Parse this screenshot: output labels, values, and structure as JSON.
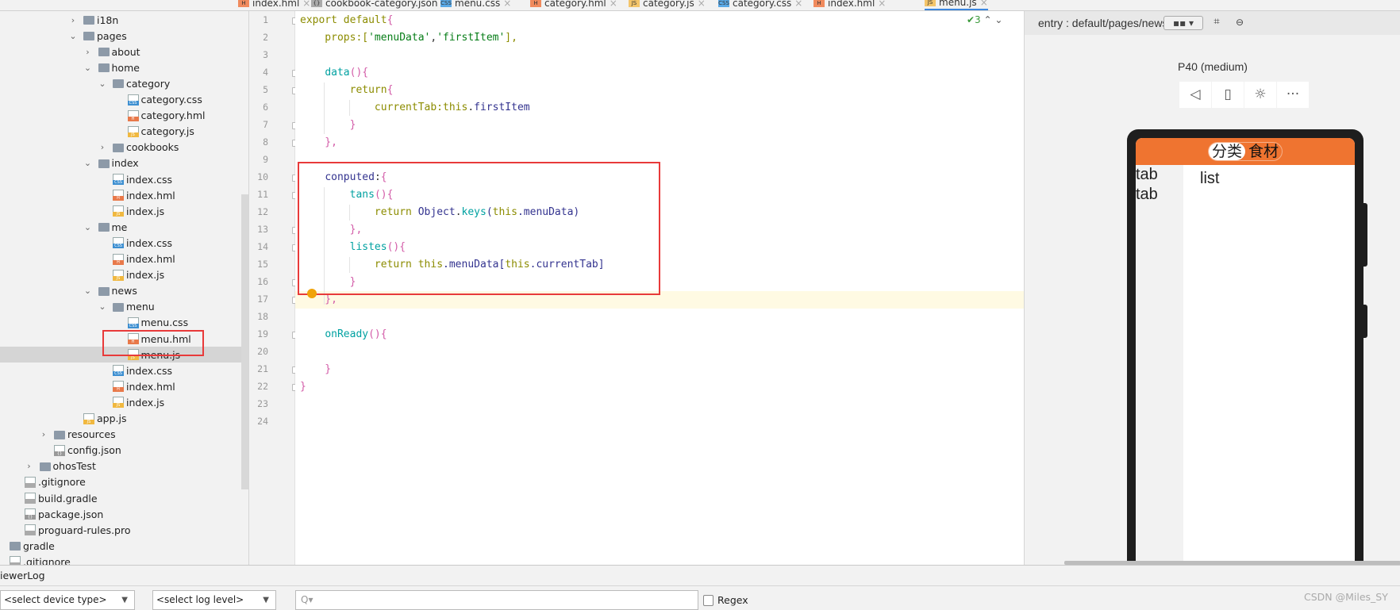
{
  "editor_tabs": [
    {
      "label": "index.hml",
      "icon": "H"
    },
    {
      "label": "cookbook-category.json",
      "icon": "{}"
    },
    {
      "label": "menu.css",
      "icon": "CSS"
    },
    {
      "label": "category.hml",
      "icon": "H"
    },
    {
      "label": "category.js",
      "icon": "JS"
    },
    {
      "label": "category.css",
      "icon": "CSS"
    },
    {
      "label": "index.hml",
      "icon": "H"
    },
    {
      "label": "menu.js",
      "icon": "JS",
      "active": true
    }
  ],
  "tree": [
    {
      "name": "i18n",
      "kind": "folder",
      "depth": 4,
      "open": false
    },
    {
      "name": "pages",
      "kind": "folder",
      "depth": 4,
      "open": true
    },
    {
      "name": "about",
      "kind": "folder",
      "depth": 5,
      "open": false
    },
    {
      "name": "home",
      "kind": "folder",
      "depth": 5,
      "open": true
    },
    {
      "name": "category",
      "kind": "folder",
      "depth": 6,
      "open": true
    },
    {
      "name": "category.css",
      "kind": "css",
      "depth": 7
    },
    {
      "name": "category.hml",
      "kind": "hml",
      "depth": 7
    },
    {
      "name": "category.js",
      "kind": "js",
      "depth": 7
    },
    {
      "name": "cookbooks",
      "kind": "folder",
      "depth": 6,
      "open": false
    },
    {
      "name": "index",
      "kind": "folder",
      "depth": 5,
      "open": true
    },
    {
      "name": "index.css",
      "kind": "css",
      "depth": 6
    },
    {
      "name": "index.hml",
      "kind": "hml",
      "depth": 6
    },
    {
      "name": "index.js",
      "kind": "js",
      "depth": 6
    },
    {
      "name": "me",
      "kind": "folder",
      "depth": 5,
      "open": true
    },
    {
      "name": "index.css",
      "kind": "css",
      "depth": 6
    },
    {
      "name": "index.hml",
      "kind": "hml",
      "depth": 6
    },
    {
      "name": "index.js",
      "kind": "js",
      "depth": 6
    },
    {
      "name": "news",
      "kind": "folder",
      "depth": 5,
      "open": true
    },
    {
      "name": "menu",
      "kind": "folder",
      "depth": 6,
      "open": true
    },
    {
      "name": "menu.css",
      "kind": "css",
      "depth": 7
    },
    {
      "name": "menu.hml",
      "kind": "hml",
      "depth": 7
    },
    {
      "name": "menu.js",
      "kind": "js",
      "depth": 7,
      "selected": true
    },
    {
      "name": "index.css",
      "kind": "css",
      "depth": 6
    },
    {
      "name": "index.hml",
      "kind": "hml",
      "depth": 6
    },
    {
      "name": "index.js",
      "kind": "js",
      "depth": 6
    },
    {
      "name": "app.js",
      "kind": "js",
      "depth": 4
    },
    {
      "name": "resources",
      "kind": "folder",
      "depth": 2,
      "open": false
    },
    {
      "name": "config.json",
      "kind": "json",
      "depth": 2
    },
    {
      "name": "ohosTest",
      "kind": "folder",
      "depth": 1,
      "open": false
    },
    {
      "name": ".gitignore",
      "kind": "other",
      "depth": 0
    },
    {
      "name": "build.gradle",
      "kind": "other",
      "depth": 0
    },
    {
      "name": "package.json",
      "kind": "json",
      "depth": 0
    },
    {
      "name": "proguard-rules.pro",
      "kind": "other",
      "depth": 0
    },
    {
      "name": "gradle",
      "kind": "folder",
      "depth": -1,
      "open": false
    },
    {
      "name": ".gitignore",
      "kind": "other",
      "depth": -1
    }
  ],
  "code_lines": [
    [
      [
        "export default",
        "k"
      ],
      [
        "{",
        "p"
      ]
    ],
    [
      [
        "    props:[",
        "k"
      ],
      [
        "'menuData'",
        "s"
      ],
      [
        ",",
        "d"
      ],
      [
        "'firstItem'",
        "s"
      ],
      [
        "],",
        "k"
      ]
    ],
    [],
    [
      [
        "    ",
        "d"
      ],
      [
        "data",
        "f"
      ],
      [
        "(){",
        "p"
      ]
    ],
    [
      [
        "        return",
        "k"
      ],
      [
        "{",
        "p"
      ]
    ],
    [
      [
        "            currentTab:",
        "k"
      ],
      [
        "this",
        "k"
      ],
      [
        ".",
        "d"
      ],
      [
        "firstItem",
        "n"
      ]
    ],
    [
      [
        "        }",
        "p"
      ]
    ],
    [
      [
        "    },",
        "p"
      ]
    ],
    [],
    [
      [
        "    ",
        "d"
      ],
      [
        "conputed",
        "n"
      ],
      [
        ":",
        "d"
      ],
      [
        "{",
        "p"
      ]
    ],
    [
      [
        "        ",
        "d"
      ],
      [
        "tans",
        "f"
      ],
      [
        "(){",
        "p"
      ]
    ],
    [
      [
        "            return ",
        "k"
      ],
      [
        "Object",
        "n"
      ],
      [
        ".",
        "d"
      ],
      [
        "keys",
        "f"
      ],
      [
        "(",
        "n"
      ],
      [
        "this",
        "k"
      ],
      [
        ".menuData)",
        "n"
      ]
    ],
    [
      [
        "        },",
        "p"
      ]
    ],
    [
      [
        "        ",
        "d"
      ],
      [
        "listes",
        "f"
      ],
      [
        "(){",
        "p"
      ]
    ],
    [
      [
        "            return ",
        "k"
      ],
      [
        "this",
        "k"
      ],
      [
        ".menuData[",
        "n"
      ],
      [
        "this",
        "k"
      ],
      [
        ".currentTab]",
        "n"
      ]
    ],
    [
      [
        "        }",
        "p"
      ]
    ],
    [
      [
        "    },",
        "p"
      ]
    ],
    [],
    [
      [
        "    ",
        "d"
      ],
      [
        "onReady",
        "f"
      ],
      [
        "(){",
        "p"
      ]
    ],
    [],
    [
      [
        "    }",
        "p"
      ]
    ],
    [
      [
        "}",
        "p"
      ]
    ],
    [],
    []
  ],
  "inspections": "✔3",
  "preview": {
    "path": "entry : default/pages/news/index",
    "device": "P40 (medium)",
    "seg_active": "分类",
    "seg_inactive": "食材",
    "tabs": [
      "tab",
      "tab"
    ],
    "list": "list"
  },
  "log": {
    "title": "iewerLog",
    "device_select": "<select device type>",
    "level_select": "<select log level>",
    "search_icon": "Q▾",
    "regex_label": "Regex"
  },
  "watermark": "CSDN @Miles_SY"
}
